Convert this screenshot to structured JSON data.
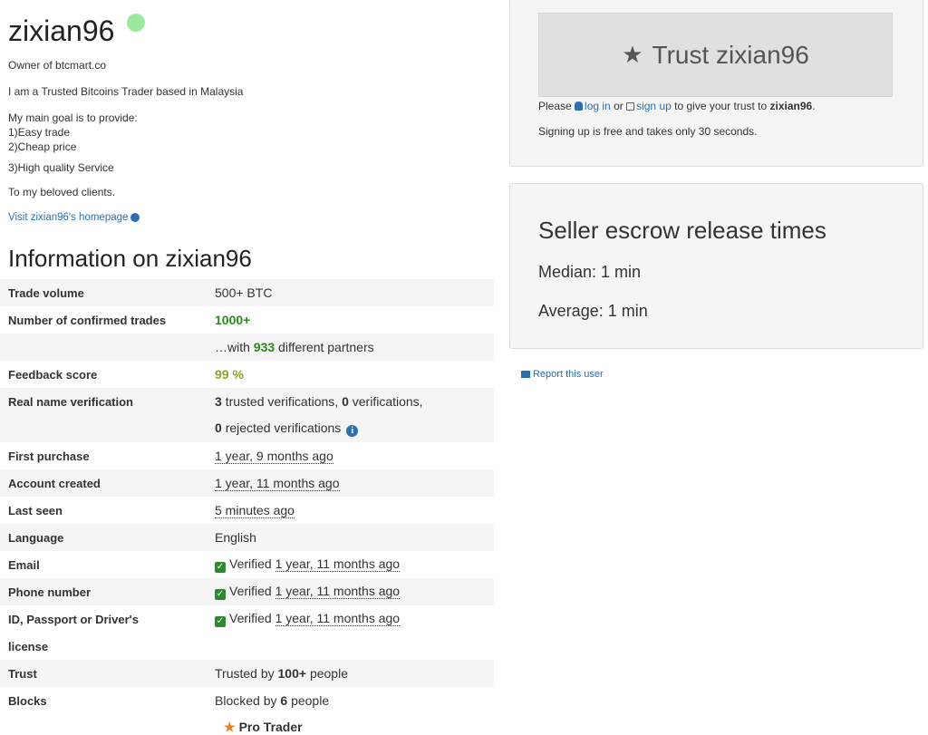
{
  "profile": {
    "username": "zixian96",
    "bio": {
      "line1": "Owner of btcmart.co",
      "line2": "I am a Trusted Bitcoins Trader based in Malaysia",
      "line3": "My main goal is to provide:",
      "line4": "1)Easy trade",
      "line5": "2)Cheap price",
      "line6": "3)High quality Service",
      "line7": "To my beloved clients."
    },
    "homepage_link": "Visit zixian96's homepage"
  },
  "info": {
    "heading": "Information on zixian96",
    "trade_volume": {
      "label": "Trade volume",
      "value": "500+ BTC"
    },
    "confirmed_trades": {
      "label": "Number of confirmed trades",
      "value": "1000+",
      "partners_prefix": "…with",
      "partners_count": "933",
      "partners_suffix": "different partners"
    },
    "feedback": {
      "label": "Feedback score",
      "value": "99 %"
    },
    "real_name": {
      "label": "Real name verification",
      "trusted_count": "3",
      "trusted_text": "trusted verifications,",
      "verif_count": "0",
      "verif_text": "verifications,",
      "rejected_count": "0",
      "rejected_text": "rejected verifications"
    },
    "first_purchase": {
      "label": "First purchase",
      "value": "1 year, 9 months ago"
    },
    "account_created": {
      "label": "Account created",
      "value": "1 year, 11 months ago"
    },
    "last_seen": {
      "label": "Last seen",
      "value": "5 minutes ago"
    },
    "language": {
      "label": "Language",
      "value": "English"
    },
    "email": {
      "label": "Email",
      "status": "Verified",
      "when": "1 year, 11 months ago"
    },
    "phone": {
      "label": "Phone number",
      "status": "Verified",
      "when": "1 year, 11 months ago"
    },
    "id_doc": {
      "label_line1": "ID, Passport or Driver's",
      "label_line2": "license",
      "status": "Verified",
      "when": "1 year, 11 months ago"
    },
    "trust": {
      "label": "Trust",
      "prefix": "Trusted by",
      "count": "100+",
      "suffix": "people"
    },
    "blocks": {
      "label": "Blocks",
      "prefix": "Blocked by",
      "count": "6",
      "suffix": "people"
    },
    "pro_trader": "Pro Trader"
  },
  "trust_panel": {
    "button_label": "Trust zixian96",
    "please": "Please",
    "login": "log in",
    "or": "or",
    "signup": "sign up",
    "give_text": "to give your trust to",
    "username": "zixian96",
    "period": ".",
    "signing_note": "Signing up is free and takes only 30 seconds."
  },
  "escrow": {
    "title": "Seller escrow release times",
    "median": "Median: 1 min",
    "average": "Average: 1 min"
  },
  "report_link": "Report this user",
  "colors": {
    "link": "#2a6fb0",
    "green": "#2a8a17",
    "olive": "#8aa51f",
    "online": "#9be89e",
    "pro": "#e67e22"
  }
}
